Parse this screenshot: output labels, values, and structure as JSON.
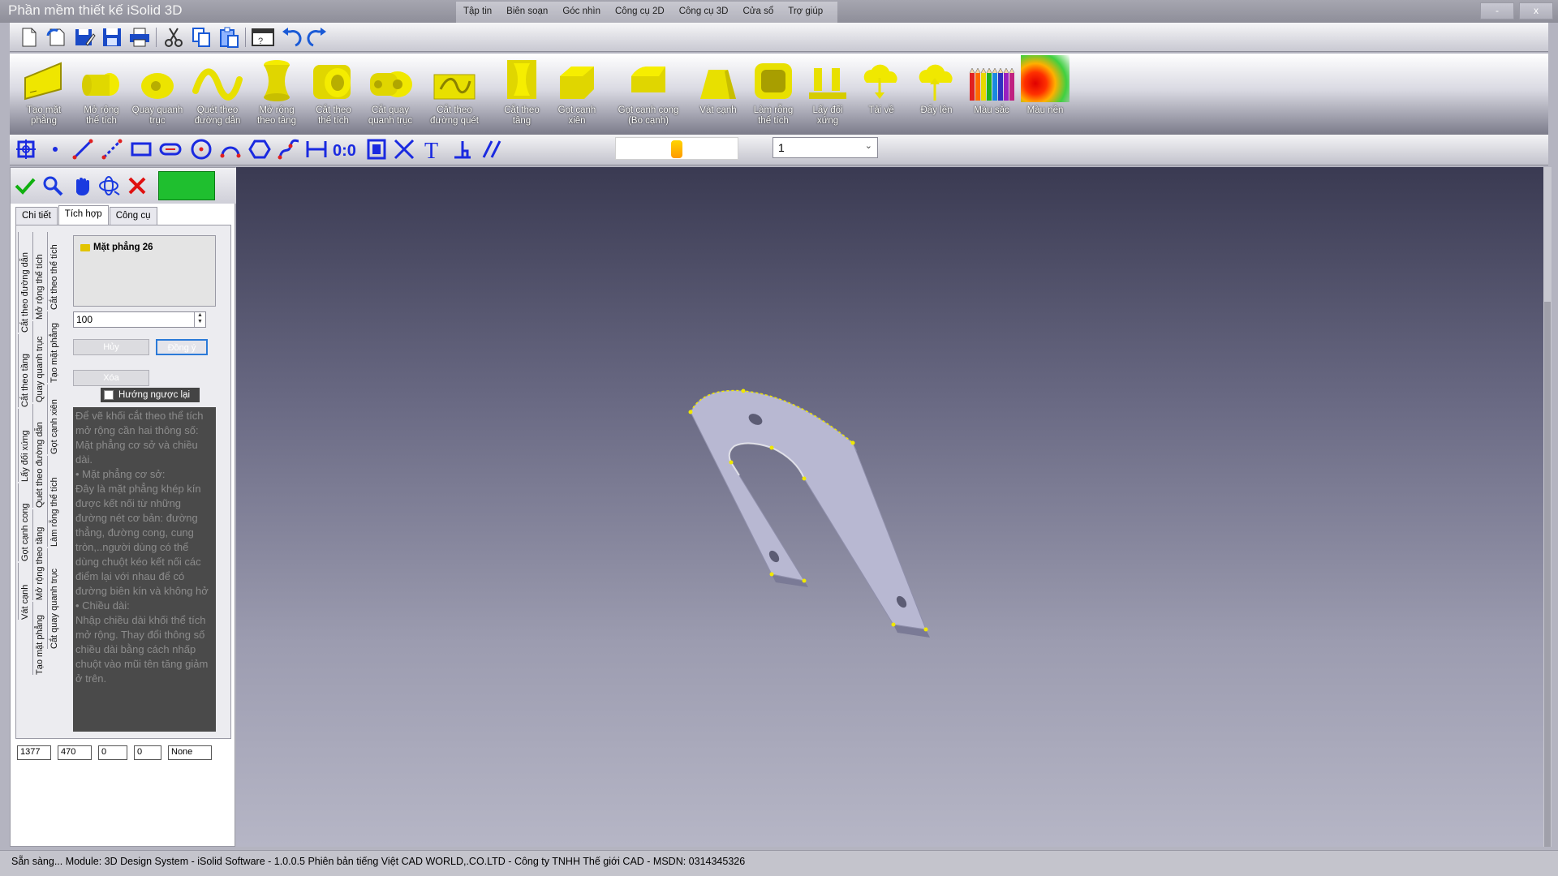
{
  "app": {
    "title": "Phần mềm thiết kế iSolid 3D"
  },
  "menu": [
    "Tập tin",
    "Biên soạn",
    "Góc nhìn",
    "Công cụ 2D",
    "Công cụ 3D",
    "Cửa sổ",
    "Trợ giúp"
  ],
  "window_buttons": {
    "minimize": "-",
    "close": "x"
  },
  "toolbar_3d": [
    {
      "label": "Tạo mặt phẳng",
      "icon": "plane-icon"
    },
    {
      "label": "Mở rộng\nthể tích",
      "icon": "extrude-icon"
    },
    {
      "label": "Quay quanh\ntrục",
      "icon": "revolve-icon"
    },
    {
      "label": "Quét theo\nđường dẫn",
      "icon": "sweep-icon"
    },
    {
      "label": "Mở rộng\ntheo tầng",
      "icon": "loft-icon"
    },
    {
      "label": "Cắt theo\nthể tích",
      "icon": "extrude-cut-icon"
    },
    {
      "label": "Cắt quay\nquanh trục",
      "icon": "revolve-cut-icon"
    },
    {
      "label": "Cắt theo\nđường quét",
      "icon": "sweep-cut-icon"
    },
    {
      "label": "Cắt theo\ntầng",
      "icon": "loft-cut-icon"
    },
    {
      "label": "Gọt cạnh\nxiên",
      "icon": "chamfer-icon"
    },
    {
      "label": "Gọt cạnh cong\n(Bo cạnh)",
      "icon": "fillet-icon"
    },
    {
      "label": "Vát cạnh",
      "icon": "draft-icon"
    },
    {
      "label": "Làm rỗng\nthể tích",
      "icon": "shell-icon"
    },
    {
      "label": "Lấy đối\nxứng",
      "icon": "mirror-icon"
    },
    {
      "label": "Tải về",
      "icon": "download-cloud-icon"
    },
    {
      "label": "Đẩy lên",
      "icon": "upload-cloud-icon"
    },
    {
      "label": "Màu sắc",
      "icon": "color-pencils-icon"
    },
    {
      "label": "Màu nền",
      "icon": "background-color-icon"
    }
  ],
  "layer_select": {
    "value": "1"
  },
  "left_panel": {
    "tabs": [
      "Chi tiết",
      "Tích hợp",
      "Công cụ"
    ],
    "active_tab": "Tích hợp",
    "vertical_tabs_col1": [
      "Cắt theo đường dẫn",
      "Cắt theo tầng",
      "Lấy đối xứng",
      "Gọt cạnh cong",
      "Vát cạnh"
    ],
    "vertical_tabs_col2": [
      "Mở rộng thể tích",
      "Quay quanh trục",
      "Quét theo đường dẫn",
      "Mở rộng theo tầng",
      "Tạo mặt phẳng"
    ],
    "vertical_tabs_col3": [
      "Cắt theo thể tích",
      "Tạo mặt phẳng",
      "Gọt cạnh xiên",
      "Làm rỗng thể tích",
      "Cắt quay quanh trục"
    ],
    "tree_item": "Mặt phẳng 26",
    "length_value": "100",
    "cancel_label": "Hủy",
    "ok_label": "Đồng ý",
    "delete_label": "Xóa",
    "reverse_label": "Hướng ngược lại",
    "help_lines": [
      "Để vẽ khối cắt theo thể tích mở rộng cần hai thông số: Mặt phẳng cơ sở và chiều dài.",
      "   • Mặt phẳng cơ sở:",
      "          Đây là mặt phẳng khép kín được kết nối từ những đường nét cơ bản: đường thẳng, đường cong, cung tròn,..người dùng có thể dùng chuột kéo kết nối các điểm lại với nhau để có đường biên kín và không hở",
      "   • Chiều dài:",
      "          Nhập chiều dài khối thể tích mở rộng. Thay đổi thông số chiều dài bằng cách nhấp chuột vào mũi tên tăng giảm ở trên."
    ],
    "coords": [
      "1377",
      "470",
      "0",
      "0",
      "None"
    ]
  },
  "status": {
    "text": "Sẵn sàng...  Module: 3D Design System - iSolid Software - 1.0.0.5 Phiên bản tiếng Việt CAD WORLD,.CO.LTD - Công ty TNHH Thế giới CAD - MSDN: 0314345326"
  },
  "colors": {
    "accent_yellow": "#e8e000",
    "swatch_green": "#1fbf2f",
    "viewport_top": "#3a3a52",
    "viewport_bottom": "#b6b6c6",
    "part_fill": "#b0b0d0"
  }
}
